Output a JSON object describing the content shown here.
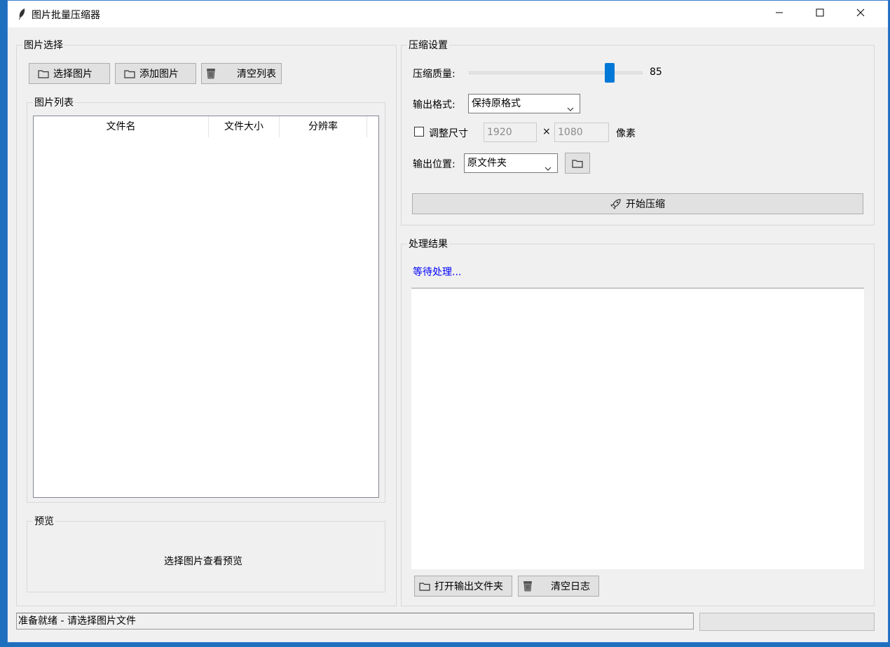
{
  "window": {
    "title": "图片批量压缩器",
    "minimize_icon": "minimize-icon",
    "maximize_icon": "maximize-icon",
    "close_icon": "close-icon"
  },
  "image_selection": {
    "group_label": "图片选择",
    "select_button": "选择图片",
    "add_button": "添加图片",
    "clear_button": "清空列表",
    "list_group_label": "图片列表",
    "columns": [
      "文件名",
      "文件大小",
      "分辨率"
    ],
    "rows": []
  },
  "preview": {
    "group_label": "预览",
    "placeholder": "选择图片查看预览"
  },
  "settings": {
    "group_label": "压缩设置",
    "quality_label": "压缩质量:",
    "quality_value": "85",
    "quality_min": 0,
    "quality_max": 100,
    "format_label": "输出格式:",
    "format_selected": "保持原格式",
    "resize_label": "调整尺寸",
    "resize_checked": false,
    "width_value": "1920",
    "times_symbol": "×",
    "height_value": "1080",
    "unit_label": "像素",
    "output_label": "输出位置:",
    "output_selected": "原文件夹",
    "start_button": "开始压缩"
  },
  "results": {
    "group_label": "处理结果",
    "status_text": "等待处理...",
    "status_color": "#0000ff",
    "open_folder_button": "打开输出文件夹",
    "clear_log_button": "清空日志"
  },
  "statusbar": {
    "text": "准备就绪 - 请选择图片文件"
  },
  "colors": {
    "accent": "#0078d7",
    "window_bg": "#f0f0f0",
    "desktop": "#1f6fbf"
  }
}
